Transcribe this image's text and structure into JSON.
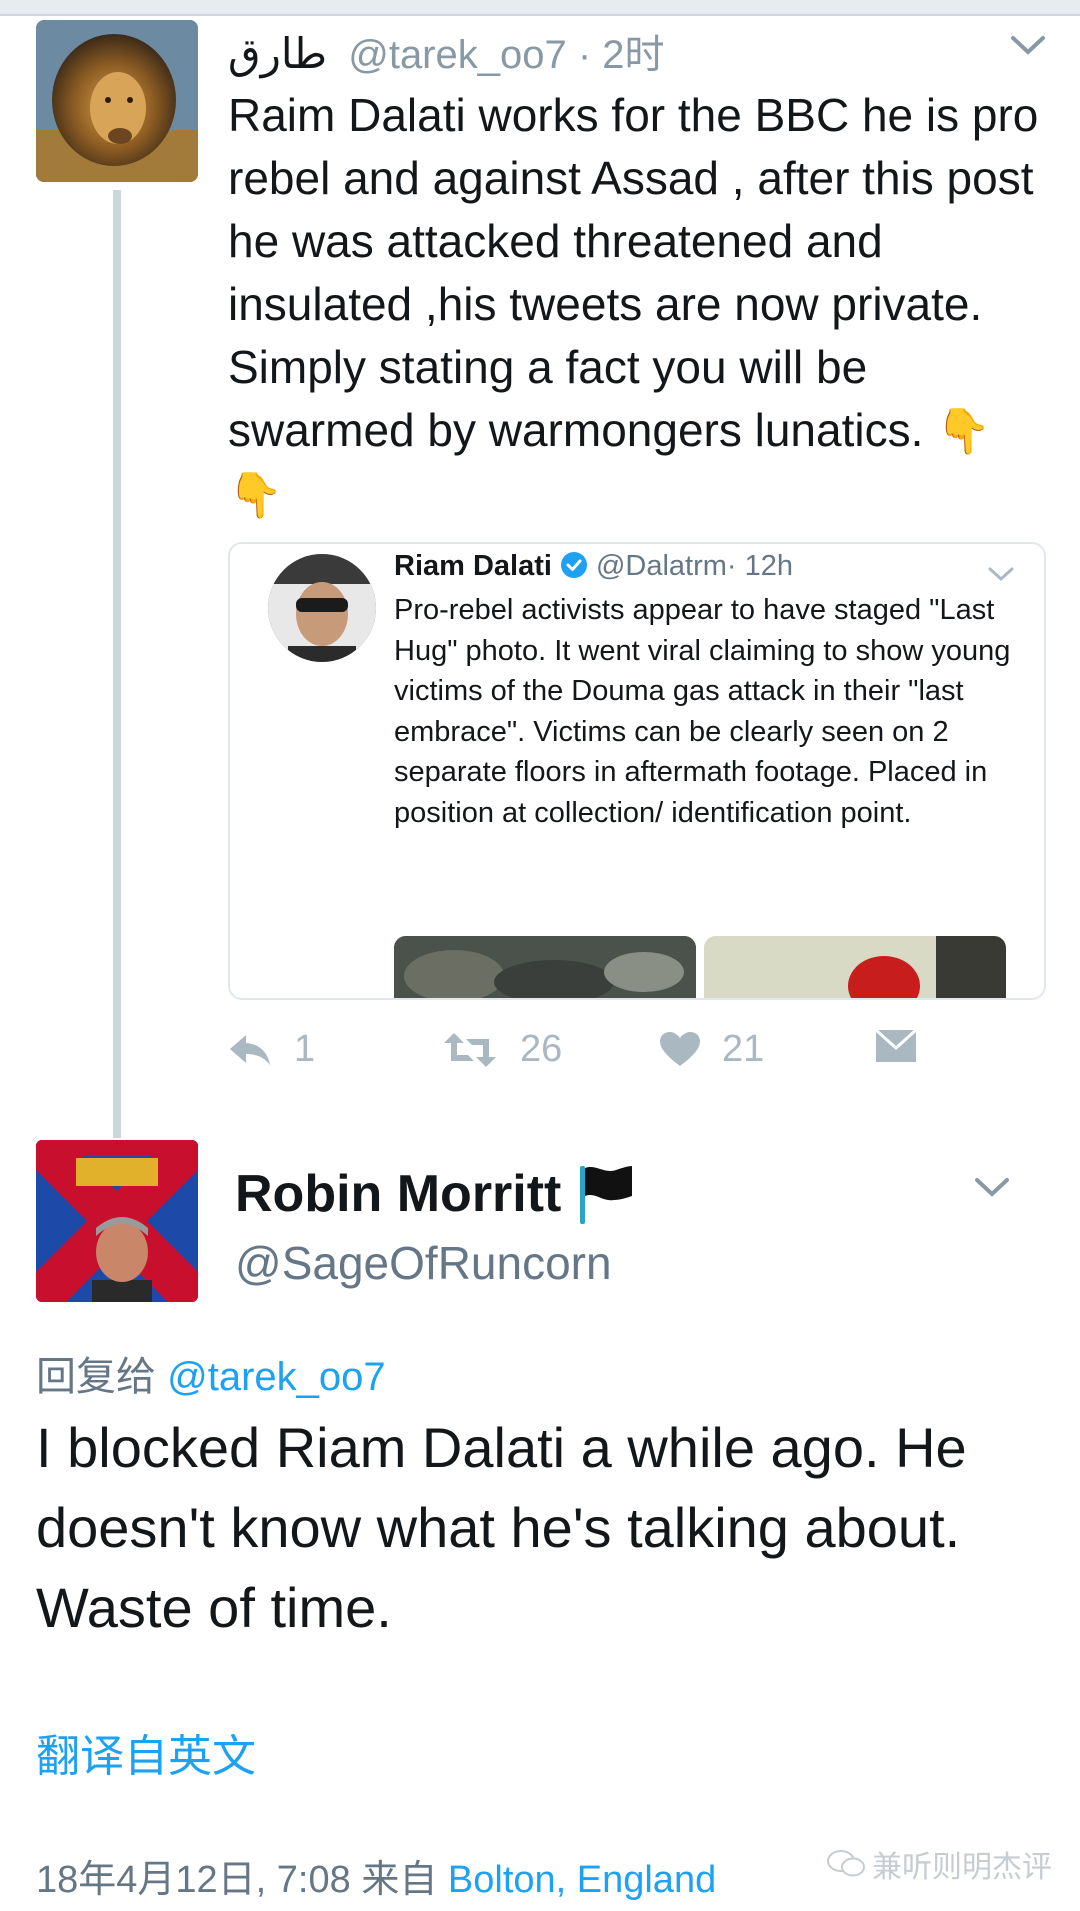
{
  "parent_tweet": {
    "display_name": "طارق",
    "handle": "@tarek_oo7",
    "time": "· 2时",
    "text": "Raim Dalati works for the BBC he is pro rebel and against Assad , after this post he was attacked threatened and insulated ,his tweets are now private. Simply stating a fact you will be swarmed by warmongers lunatics.",
    "emoji_1": "👇",
    "emoji_2": "👇",
    "avatar_icon": "lion-avatar",
    "menu_icon": "chevron-down-icon"
  },
  "quoted_tweet": {
    "name": "Riam Dalati",
    "verified_icon": "verified-badge-icon",
    "handle": "@Dalatrm",
    "time": "· 12h",
    "text": "Pro-rebel activists appear to have staged \"Last Hug\" photo. It went viral claiming to show young victims of the Douma gas attack in their \"last embrace\". Victims can be clearly seen on 2 separate floors in aftermath footage. Placed in position at collection/ identification point."
  },
  "actions": {
    "reply_count": "1",
    "retweet_count": "26",
    "like_count": "21",
    "icons": [
      "reply-icon",
      "retweet-icon",
      "like-icon",
      "dm-icon"
    ]
  },
  "reply_tweet": {
    "name": "Robin Morritt",
    "flag_icon": "black-flag-icon",
    "handle": "@SageOfRuncorn",
    "reply_to_label": "回复给",
    "reply_to_handle": "@tarek_oo7",
    "text": "I blocked Riam Dalati a while ago. He doesn't know what he's talking about. Waste of time.",
    "translate_label": "翻译自英文",
    "date": "18年4月12日, 7:08",
    "from_label": "来自",
    "location": "Bolton, England"
  },
  "watermark": {
    "text": "兼听则明杰评"
  },
  "colors": {
    "link": "#1da1f2",
    "secondary_text": "#657786",
    "action_gray": "#aab8c2",
    "thread_line": "#ccd6dd"
  }
}
